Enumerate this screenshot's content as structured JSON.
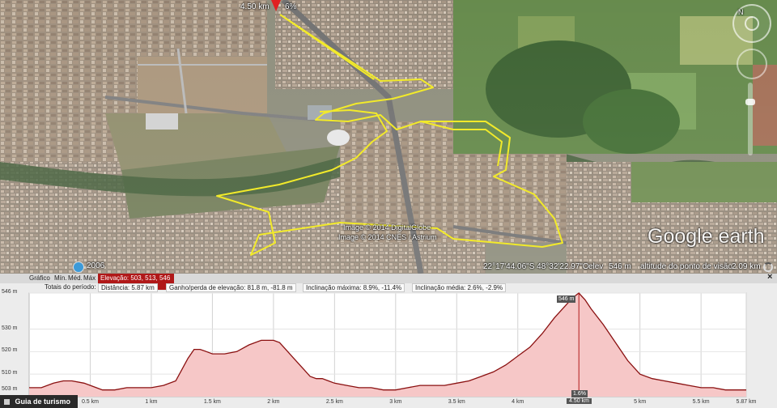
{
  "map": {
    "position_marker": "4.50 km",
    "position_grade": "6%",
    "copyright_line1": "Image © 2014 DigitalGlobe",
    "copyright_line2": "Image © 2014 CNES / Astrium",
    "year_badge": "2006",
    "status_coords": "22°17'44.06\"S   48°32'22.97\"O",
    "status_elev_label": "elev",
    "status_elev_value": "546 m",
    "status_eye_label": "altitude do ponto de visão",
    "status_eye_value": "2.09 km",
    "logo": "Google earth",
    "compass_label": "N"
  },
  "profile": {
    "toolbar": {
      "graph_label": "Gráfico",
      "min_label": "Mín.",
      "avg_label": "Méd.",
      "max_label": "Máx",
      "elevation_badge": "Elevação: 503, 513, 546 m",
      "close_label": "×"
    },
    "stats": {
      "totals_label": "Totais do período:",
      "distance": "Distância: 5.87 km",
      "gain_loss": "Ganho/perda de elevação: 81.8 m, -81.8 m",
      "max_slope": "Inclinação máxima: 8.9%, -11.4%",
      "avg_slope": "Inclinação média: 2.6%, -2.9%"
    },
    "cursor_elevation_label": "546 m",
    "cursor_grade_label": "1.6%",
    "cursor_distance_label": "4.50 km"
  },
  "tour_guide": "Guia de turismo",
  "chart_data": {
    "type": "area",
    "x_unit": "km",
    "y_unit": "m",
    "xlim": [
      0,
      5.87
    ],
    "ylim": [
      500,
      546
    ],
    "x_ticks": [
      {
        "v": 0.5,
        "label": "0.5 km"
      },
      {
        "v": 1.0,
        "label": "1 km"
      },
      {
        "v": 1.5,
        "label": "1.5 km"
      },
      {
        "v": 2.0,
        "label": "2 km"
      },
      {
        "v": 2.5,
        "label": "2.5 km"
      },
      {
        "v": 3.0,
        "label": "3 km"
      },
      {
        "v": 3.5,
        "label": "3.5 km"
      },
      {
        "v": 4.0,
        "label": "4 km"
      },
      {
        "v": 4.5,
        "label": "4.50 km"
      },
      {
        "v": 5.0,
        "label": "5 km"
      },
      {
        "v": 5.5,
        "label": "5.5 km"
      },
      {
        "v": 5.87,
        "label": "5.87 km"
      }
    ],
    "y_ticks": [
      {
        "v": 503,
        "label": "503 m"
      },
      {
        "v": 510,
        "label": "510 m"
      },
      {
        "v": 520,
        "label": "520 m"
      },
      {
        "v": 530,
        "label": "530 m"
      },
      {
        "v": 546,
        "label": "546 m"
      }
    ],
    "x": [
      0,
      0.1,
      0.2,
      0.28,
      0.35,
      0.45,
      0.55,
      0.6,
      0.7,
      0.8,
      0.9,
      1.0,
      1.1,
      1.2,
      1.25,
      1.3,
      1.35,
      1.4,
      1.45,
      1.5,
      1.6,
      1.7,
      1.8,
      1.9,
      2.0,
      2.05,
      2.1,
      2.15,
      2.2,
      2.25,
      2.3,
      2.35,
      2.4,
      2.45,
      2.5,
      2.6,
      2.7,
      2.8,
      2.9,
      3.0,
      3.1,
      3.2,
      3.3,
      3.4,
      3.5,
      3.6,
      3.7,
      3.8,
      3.9,
      4.0,
      4.1,
      4.2,
      4.3,
      4.4,
      4.45,
      4.5,
      4.55,
      4.6,
      4.7,
      4.8,
      4.9,
      5.0,
      5.1,
      5.2,
      5.3,
      5.4,
      5.5,
      5.6,
      5.7,
      5.87
    ],
    "y": [
      504,
      504,
      506,
      507,
      507,
      506,
      504,
      503,
      503,
      504,
      504,
      504,
      505,
      507,
      512,
      517,
      521,
      521,
      520,
      519,
      519,
      520,
      523,
      525,
      525,
      524,
      521,
      518,
      515,
      512,
      509,
      508,
      508,
      507,
      506,
      505,
      504,
      504,
      503,
      503,
      504,
      505,
      505,
      505,
      506,
      507,
      509,
      511,
      514,
      518,
      522,
      528,
      535,
      541,
      544,
      546,
      543,
      539,
      532,
      524,
      516,
      510,
      508,
      507,
      506,
      505,
      504,
      504,
      503,
      503
    ],
    "cursor_x": 4.5,
    "fill_color": "#f6c7c7",
    "line_color": "#8a1010"
  }
}
